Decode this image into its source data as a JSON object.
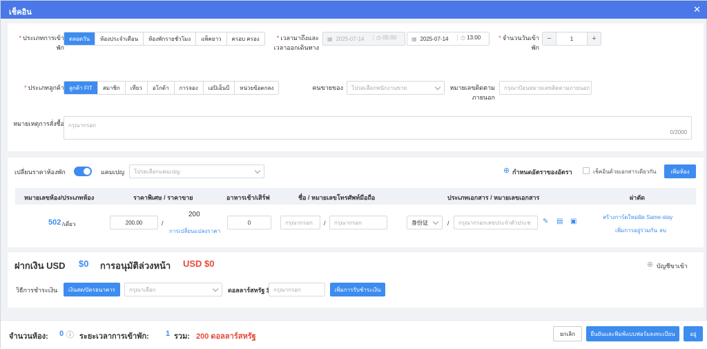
{
  "window": {
    "title": "เช็คอิน"
  },
  "form": {
    "stay_type": {
      "label": "ประเภทการเข้าพัก",
      "options": [
        "ตลอดวัน",
        "ห้องประจำเดือน",
        "ห้องพักรายชั่วโมง",
        "แพ็คยาว",
        "ครอบ ครอง"
      ],
      "selected": "ตลอดวัน"
    },
    "arrival": {
      "label": "เวลามาถึงและเวลาออกเดินทาง",
      "date_from": "2025-07-14",
      "time_from": "05:00",
      "date_to": "2025-07-14",
      "time_to": "13:00"
    },
    "nights": {
      "label": "จำนวนวันเข้าพัก",
      "value": "1",
      "minus": "−",
      "plus": "+"
    },
    "guest_type": {
      "label": "ประเภทลูกค้า",
      "options": [
        "ลูกค้า FIT",
        "สมาชิก",
        "เที่ยว",
        "อโกด้า",
        "การจอง",
        "เอปิเอ็นบี",
        "หน่วยข้อตกลง"
      ],
      "selected": "ลูกค้า FIT"
    },
    "salesperson": {
      "label": "คนขายของ",
      "placeholder": "โปรดเลือกพนักงานขาย"
    },
    "external_id": {
      "label": "หมายเลขติดตามภายนอก",
      "placeholder": "กรุณาป้อนหมายเลขติดตามภายนอก"
    },
    "order_note": {
      "label": "หมายเหตุการสั่งซื้อ",
      "placeholder": "กรุณากรอก",
      "counter": "0/2000"
    }
  },
  "rooms": {
    "change_price_label": "เปลี่ยนราคาห้องพัก",
    "campaign_label": "แคมเปญ",
    "campaign_placeholder": "โปรดเลือกแคมเปญ",
    "set_rate_label": "กำหนดอัตราของอัตรา",
    "same_doc_label": "เช็คอินด้วยเอกสารเดียวกัน",
    "add_room_button": "เพิ่มห้อง",
    "columns": [
      "หมายเลขห้อง/ประเภทห้อง",
      "ราคาพิเศษ / ราคาขาย",
      "อาหารเช้า/เสิร์ฟ",
      "ชื่อ / หมายเลขโทรศัพท์มือถือ",
      "ประเภทเอกสาร / หมายเลขเอกสาร",
      "ผ่าตัด"
    ],
    "row": {
      "room_no": "502",
      "room_type": "/เดี่ยว",
      "special_price": "200.00",
      "sale_price": "200",
      "change_price_link": "การเปลี่ยนแปลงราคา",
      "breakfast": "0",
      "name_placeholder": "กรุณากรอก",
      "phone_placeholder": "กรุณากรอก",
      "doc_type": "身份证",
      "doc_placeholder": "กรุณากรอกเลขประจำตัวประช",
      "action_new_card": "สร้างการ์ดใหม่",
      "action_same_stay": "ผัด Same-stay",
      "action_add_guest": "เพิ่มการอยู่ร่วมกัน",
      "action_delete": "ลบ"
    }
  },
  "payment": {
    "deposit_label": "ฝากเงิน USD",
    "deposit_value": "$0",
    "preauth_label": "การอนุมัติล่วงหน้า",
    "preauth_value": "USD $0",
    "guest_account_label": "บัญชีขาเข้า",
    "method_label": "วิธีการชำระเงิน",
    "method_button": "เงินสด/บัตรธนาคาร",
    "method_placeholder": "กรุณาเลือก",
    "usd_label": "ดอลลาร์สหรัฐ $",
    "usd_placeholder": "กรุณากรอก",
    "add_payment_button": "เพิ่มการรับชำระเงิน"
  },
  "footer": {
    "rooms_label": "จำนวนห้อง:",
    "rooms_value": "0",
    "duration_label": "ระยะเวลาการเข้าพัก:",
    "duration_value": "1",
    "total_label": "รวม:",
    "total_value": "200 ดอลลาร์สหรัฐ",
    "cancel_button": "ยกเลิก",
    "confirm_print_button": "ยืนยันและพิมพ์แบบฟอร์มลงทะเบียน",
    "ok_button": "อยู่"
  },
  "colors": {
    "accent": "#3d8cf0",
    "header": "#4a78e8",
    "danger": "#e64a3b"
  }
}
